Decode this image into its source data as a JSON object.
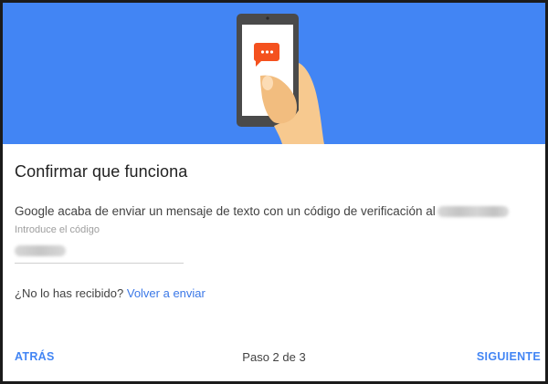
{
  "colors": {
    "hero_background": "#4285f4",
    "accent": "#4285f4",
    "link": "#3b78e7",
    "chat_bubble": "#f4511e"
  },
  "hero": {
    "illustration": "hand-holding-phone-with-message",
    "icon": "sms-bubble-icon"
  },
  "dialog": {
    "title": "Confirmar que funciona",
    "description": "Google acaba de enviar un mensaje de texto con un código de verificación al",
    "redacted_phone": "",
    "code_field": {
      "label": "Introduce el código",
      "value": ""
    },
    "resend": {
      "question": "¿No lo has recibido?",
      "link": "Volver a enviar"
    }
  },
  "footer": {
    "back": "ATRÁS",
    "step": "Paso 2 de 3",
    "next": "SIGUIENTE"
  }
}
